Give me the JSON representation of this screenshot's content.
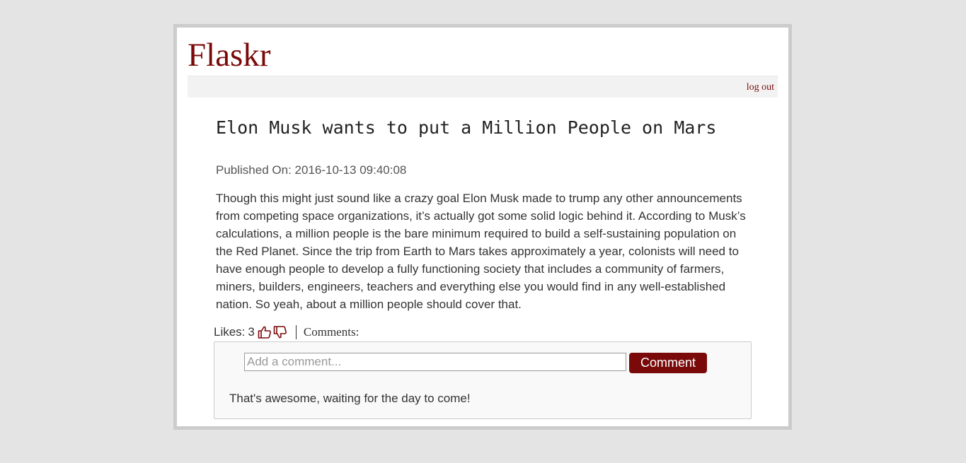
{
  "app": {
    "title": "Flaskr"
  },
  "nav": {
    "logout_label": "log out"
  },
  "post": {
    "title": "Elon Musk wants to put a Million People on Mars",
    "published_label": "Published On:",
    "published_at": "2016-10-13 09:40:08",
    "body": "Though this might just sound like a crazy goal Elon Musk made to trump any other announcements from competing space organizations, it’s actually got some solid logic behind it. According to Musk’s calculations, a million people is the bare minimum required to build a self-sustaining population on the Red Planet. Since the trip from Earth to Mars takes approximately a year, colonists will need to have enough people to develop a fully functioning society that includes a community of farmers, miners, builders, engineers, teachers and everything else you would find in any well-established nation. So yeah, about a million people should cover that."
  },
  "likes": {
    "label": "Likes:",
    "count": "3",
    "like_icon": "thumbs-up-icon",
    "dislike_icon": "thumbs-down-icon"
  },
  "comments": {
    "label": "Comments:",
    "input_placeholder": "Add a comment...",
    "input_value": "",
    "submit_label": "Comment",
    "items": [
      {
        "text": "That's awesome, waiting for the day to come!"
      }
    ]
  },
  "colors": {
    "accent": "#7a0a0a",
    "page_background": "#e4e4e4",
    "frame_border": "#cccccc"
  }
}
